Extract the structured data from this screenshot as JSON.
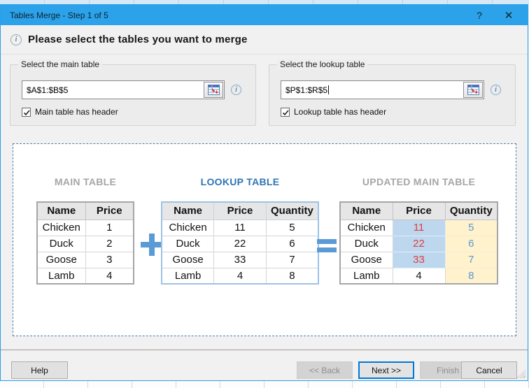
{
  "window": {
    "title": "Tables Merge - Step 1 of 5",
    "help_glyph": "?",
    "close_glyph": "✕"
  },
  "banner": {
    "text": "Please select the tables you want to merge",
    "icon": "i"
  },
  "groups": {
    "main": {
      "legend": "Select the main table",
      "range_value": "$A$1:$B$5",
      "checkbox_label": "Main table has header",
      "checked": true
    },
    "lookup": {
      "legend": "Select the lookup table",
      "range_value": "$P$1:$R$5",
      "checkbox_label": "Lookup table has header",
      "checked": true
    }
  },
  "preview": {
    "main_table": {
      "title": "MAIN TABLE",
      "headers": [
        "Name",
        "Price"
      ],
      "rows": [
        [
          "Chicken",
          "1"
        ],
        [
          "Duck",
          "2"
        ],
        [
          "Goose",
          "3"
        ],
        [
          "Lamb",
          "4"
        ]
      ]
    },
    "lookup_table": {
      "title": "LOOKUP TABLE",
      "headers": [
        "Name",
        "Price",
        "Quantity"
      ],
      "rows": [
        [
          "Chicken",
          "11",
          "5"
        ],
        [
          "Duck",
          "22",
          "6"
        ],
        [
          "Goose",
          "33",
          "7"
        ],
        [
          "Lamb",
          "4",
          "8"
        ]
      ]
    },
    "updated_table": {
      "title": "UPDATED MAIN TABLE",
      "headers": [
        "Name",
        "Price",
        "Quantity"
      ],
      "rows": [
        [
          "Chicken",
          "11",
          "5"
        ],
        [
          "Duck",
          "22",
          "6"
        ],
        [
          "Goose",
          "33",
          "7"
        ],
        [
          "Lamb",
          "4",
          "8"
        ]
      ],
      "cell_styles": [
        [
          "",
          "cell-price-new",
          "cell-qty-new"
        ],
        [
          "",
          "cell-price-new",
          "cell-qty-new"
        ],
        [
          "",
          "cell-price-new",
          "cell-qty-new"
        ],
        [
          "",
          "",
          "cell-qty-new"
        ]
      ]
    }
  },
  "footer": {
    "help": "Help",
    "back": "<< Back",
    "next": "Next >>",
    "finish": "Finish",
    "cancel": "Cancel"
  },
  "colors": {
    "titlebar": "#2ba2ea",
    "dialog-border": "#2a9fe8",
    "accent": "#0078d7",
    "symbol": "#5b9bd5",
    "muted-title": "#a6a6a6",
    "lookup-title": "#2e75b6",
    "price-bg": "#bdd7ee",
    "price-text": "#e33b3b",
    "qty-bg": "#fff2cc",
    "qty-text": "#5b9bd5"
  }
}
